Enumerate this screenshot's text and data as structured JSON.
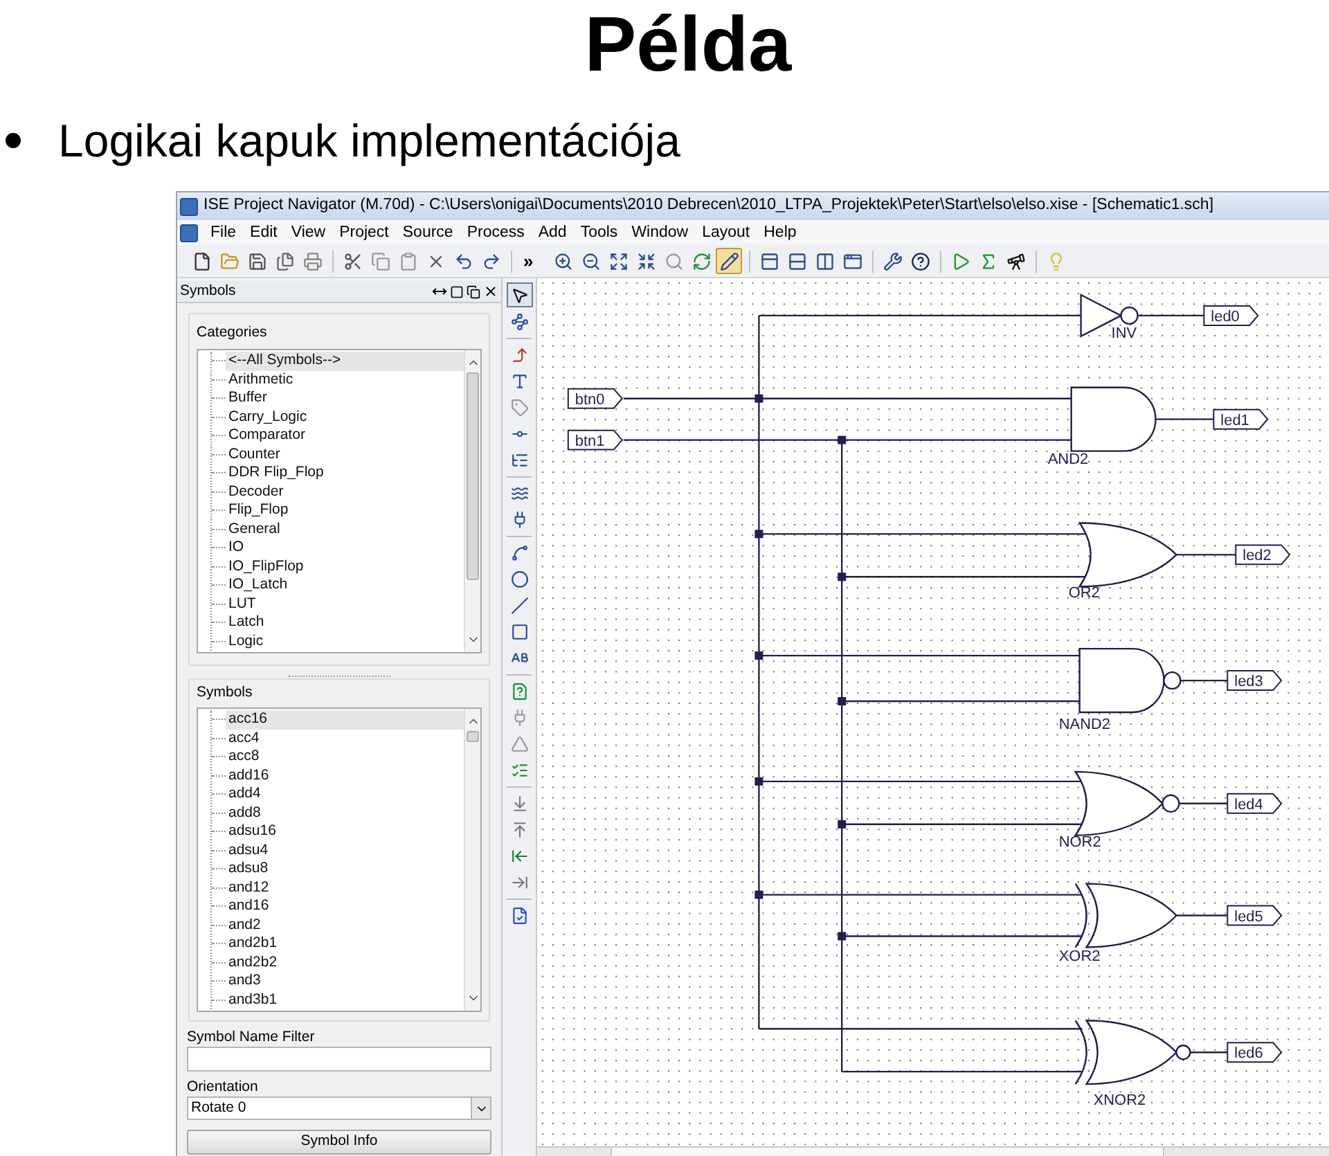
{
  "slide": {
    "title": "Példa",
    "bullets": [
      "Logikai kapuk implementációja"
    ]
  },
  "window": {
    "title": "ISE Project Navigator (M.70d) - C:\\Users\\onigai\\Documents\\2010 Debrecen\\2010_LTPA_Projektek\\Peter\\Start\\elso\\elso.xise - [Schematic1.sch]"
  },
  "menu": [
    "File",
    "Edit",
    "View",
    "Project",
    "Source",
    "Process",
    "Add",
    "Tools",
    "Window",
    "Layout",
    "Help"
  ],
  "toolbar": {
    "overflow": "»",
    "buttons": [
      {
        "selected": false
      },
      {
        "selected": false
      },
      {
        "selected": false
      },
      {
        "selected": false
      },
      {
        "selected": false
      },
      {
        "selected": false
      },
      {
        "selected": false
      },
      {
        "selected": false
      },
      {
        "selected": false
      },
      {
        "selected": false
      },
      {
        "selected": false
      },
      {
        "selected": false
      },
      {
        "selected": false
      },
      {
        "selected": false
      },
      {
        "selected": false
      },
      {
        "selected": false
      },
      {
        "selected": false
      },
      {
        "selected": true
      },
      {
        "selected": false
      },
      {
        "selected": false
      },
      {
        "selected": false
      },
      {
        "selected": false
      },
      {
        "selected": false
      },
      {
        "selected": false
      },
      {
        "selected": false
      },
      {
        "selected": false
      },
      {
        "selected": false
      },
      {
        "selected": false
      }
    ]
  },
  "symbols_panel": {
    "title": "Symbols",
    "categories_label": "Categories",
    "categories": [
      {
        "label": "<--All Symbols-->",
        "selected": true
      },
      {
        "label": "Arithmetic",
        "selected": false
      },
      {
        "label": "Buffer",
        "selected": false
      },
      {
        "label": "Carry_Logic",
        "selected": false
      },
      {
        "label": "Comparator",
        "selected": false
      },
      {
        "label": "Counter",
        "selected": false
      },
      {
        "label": "DDR Flip_Flop",
        "selected": false
      },
      {
        "label": "Decoder",
        "selected": false
      },
      {
        "label": "Flip_Flop",
        "selected": false
      },
      {
        "label": "General",
        "selected": false
      },
      {
        "label": "IO",
        "selected": false
      },
      {
        "label": "IO_FlipFlop",
        "selected": false
      },
      {
        "label": "IO_Latch",
        "selected": false
      },
      {
        "label": "LUT",
        "selected": false
      },
      {
        "label": "Latch",
        "selected": false
      },
      {
        "label": "Logic",
        "selected": false
      }
    ],
    "symbols_label": "Symbols",
    "symbols": [
      {
        "label": "acc16",
        "selected": true
      },
      {
        "label": "acc4",
        "selected": false
      },
      {
        "label": "acc8",
        "selected": false
      },
      {
        "label": "add16",
        "selected": false
      },
      {
        "label": "add4",
        "selected": false
      },
      {
        "label": "add8",
        "selected": false
      },
      {
        "label": "adsu16",
        "selected": false
      },
      {
        "label": "adsu4",
        "selected": false
      },
      {
        "label": "adsu8",
        "selected": false
      },
      {
        "label": "and12",
        "selected": false
      },
      {
        "label": "and16",
        "selected": false
      },
      {
        "label": "and2",
        "selected": false
      },
      {
        "label": "and2b1",
        "selected": false
      },
      {
        "label": "and2b2",
        "selected": false
      },
      {
        "label": "and3",
        "selected": false
      },
      {
        "label": "and3b1",
        "selected": false
      }
    ],
    "filter_label": "Symbol Name Filter",
    "orientation_label": "Orientation",
    "orientation_value": "Rotate 0",
    "info_button": "Symbol Info"
  },
  "tool_palette": {
    "buttons": [
      {
        "selected": true
      },
      {
        "selected": false
      },
      {
        "selected": false
      },
      {
        "selected": false
      },
      {
        "selected": false
      },
      {
        "selected": false
      },
      {
        "selected": false
      },
      {
        "selected": false
      },
      {
        "selected": false
      },
      {
        "selected": false
      },
      {
        "selected": false
      },
      {
        "selected": false
      },
      {
        "selected": false
      },
      {
        "selected": false
      },
      {
        "selected": false
      },
      {
        "selected": false
      },
      {
        "selected": false
      },
      {
        "selected": false
      },
      {
        "selected": false
      },
      {
        "selected": false
      },
      {
        "selected": false
      },
      {
        "selected": false
      },
      {
        "selected": false
      }
    ]
  },
  "schematic": {
    "inputs": [
      {
        "label": "btn0"
      },
      {
        "label": "btn1"
      }
    ],
    "gates": [
      {
        "kind": "inv",
        "label": "INV",
        "output": "led0"
      },
      {
        "kind": "and",
        "label": "AND2",
        "output": "led1"
      },
      {
        "kind": "or",
        "label": "OR2",
        "output": "led2"
      },
      {
        "kind": "nand",
        "label": "NAND2",
        "output": "led3"
      },
      {
        "kind": "nor",
        "label": "NOR2",
        "output": "led4"
      },
      {
        "kind": "xor",
        "label": "XOR2",
        "output": "led5"
      },
      {
        "kind": "xnor",
        "label": "XNOR2",
        "output": "led6"
      }
    ]
  }
}
